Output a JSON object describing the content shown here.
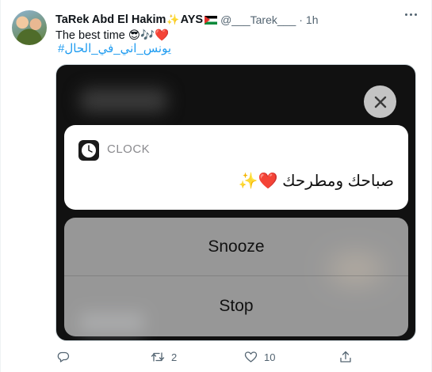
{
  "tweet": {
    "author_name": "TaRek Abd El Hakim",
    "author_name_suffix": "AYS",
    "handle": "@___Tarek___",
    "separator": "·",
    "time": "1h",
    "text_line1": "The best time 😎🎶❤️",
    "hashtag": "#يونس_اني_في_الحال",
    "icons": {
      "sparkle": "sparkle-icon",
      "flag": "palestine-flag-icon",
      "more": "more-icon"
    }
  },
  "media": {
    "notification": {
      "app_name": "CLOCK",
      "message": "صباحك ومطرحك ❤️✨"
    },
    "actions": {
      "snooze": "Snooze",
      "stop": "Stop"
    }
  },
  "footer": {
    "reply_count": "",
    "retweet_count": "2",
    "like_count": "10",
    "icons": [
      "reply-icon",
      "retweet-icon",
      "like-icon",
      "share-icon"
    ]
  },
  "colors": {
    "link": "#1d9bf0",
    "muted": "#536471",
    "heart": "#e02424"
  }
}
